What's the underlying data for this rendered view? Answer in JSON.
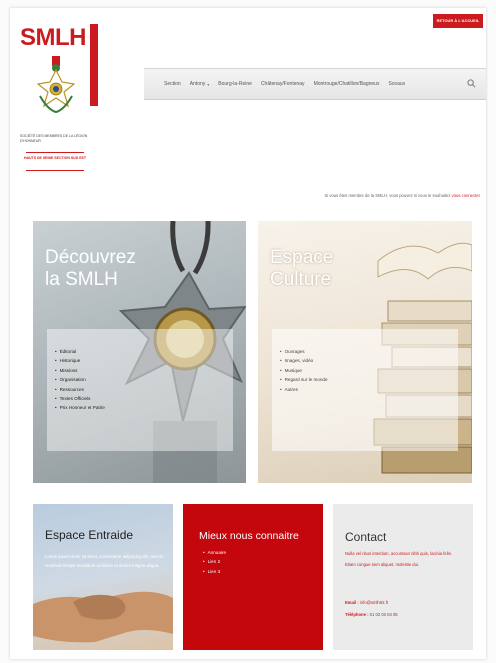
{
  "header": {
    "logo": "SMLH",
    "caption": "Société des membres de la Légion d'honneur",
    "section": "Hauts de Seine Section Sud Est",
    "return_button": "Retour à l'accueil"
  },
  "nav": {
    "items": [
      {
        "label": "Section",
        "dropdown": false
      },
      {
        "label": "Antony",
        "dropdown": true
      },
      {
        "label": "Bourg-la-Reine",
        "dropdown": false
      },
      {
        "label": "Châtenay/Fontenay",
        "dropdown": false
      },
      {
        "label": "Montrouge/Chatillon/Bagneux",
        "dropdown": false
      },
      {
        "label": "Sceaux",
        "dropdown": false
      }
    ],
    "search_icon": "search-icon"
  },
  "member_notice": {
    "text": "Si vous êtes membre de la SMLH, vous pouvez si vous le souhaitez ",
    "link": "vous connecter"
  },
  "tiles": {
    "smlh": {
      "title_line1": "Découvrez",
      "title_line2": "la SMLH",
      "items": [
        "Éditorial",
        "Historique",
        "Missions",
        "Organisation",
        "Ressources",
        "Textes Officiels",
        "Prix Honneur et Patrie"
      ]
    },
    "culture": {
      "title_line1": "Espace",
      "title_line2": "Culture",
      "items": [
        "Ouvrages",
        "Images, vidéo",
        "Musique",
        "Regard sur le monde",
        "Autres"
      ]
    },
    "entraide": {
      "title": "Espace Entraide",
      "text": "Lorem ipsum dolor sit amet, consectetur adipiscing elit, sed do eiusmod tempor incididunt ut labore et dolore magna aliqua."
    },
    "mieux": {
      "title": "Mieux nous connaitre",
      "items": [
        "Annuaire",
        "Lien 2",
        "Lien 3"
      ]
    },
    "contact": {
      "title": "Contact",
      "text": "Nulla vel risus interdum, accumsan nibh quis, lacinia felis. Etiam congue sem aliquet, molestie dui.",
      "email_label": "Email :",
      "email": "info@smlh92.fr",
      "phone_label": "Téléphone :",
      "phone": "01 02 03 04 05"
    }
  },
  "colors": {
    "brand_red": "#cc1b1f",
    "tile_red": "#c4060d",
    "nav_bg": "#ececec"
  }
}
